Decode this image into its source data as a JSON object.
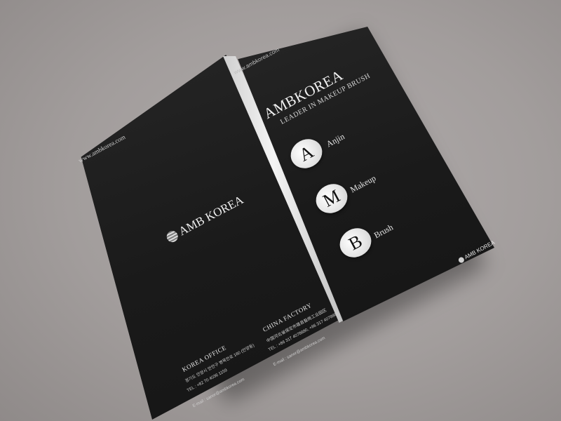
{
  "brochure": {
    "website": "www.ambkorea.com",
    "front": {
      "brand": "AMBKOREA",
      "tagline": "LEADER IN MAKEUP BRUSH",
      "letters": [
        {
          "letter": "A",
          "word": "Anjin"
        },
        {
          "letter": "M",
          "word": "Makeup"
        },
        {
          "letter": "B",
          "word": "Brush"
        }
      ],
      "logo_text": "AMB KOREA"
    },
    "back": {
      "logo_text": "AMB KOREA",
      "korea_office": {
        "title": "KOREA OFFICE",
        "address": "경기도 안양시 만안구 병목안로 160 (안양동)",
        "tel": "TEL : +82 70 4036 1159",
        "email": "E-mail : sanor@ambkorea.com"
      },
      "china_factory": {
        "title": "CHINA FACTORY",
        "address": "中国河北省保定市雄县昝岗工业园区",
        "tel": "TEL : +86 317 4078880, +86 317 4078881",
        "email": "E-mail : sanor@ambkorea.com"
      }
    }
  },
  "colors": {
    "background": "#a29d9c",
    "cover": "#1c1c1c",
    "text": "#e6e6e6",
    "circle": "#e3e3e3"
  }
}
